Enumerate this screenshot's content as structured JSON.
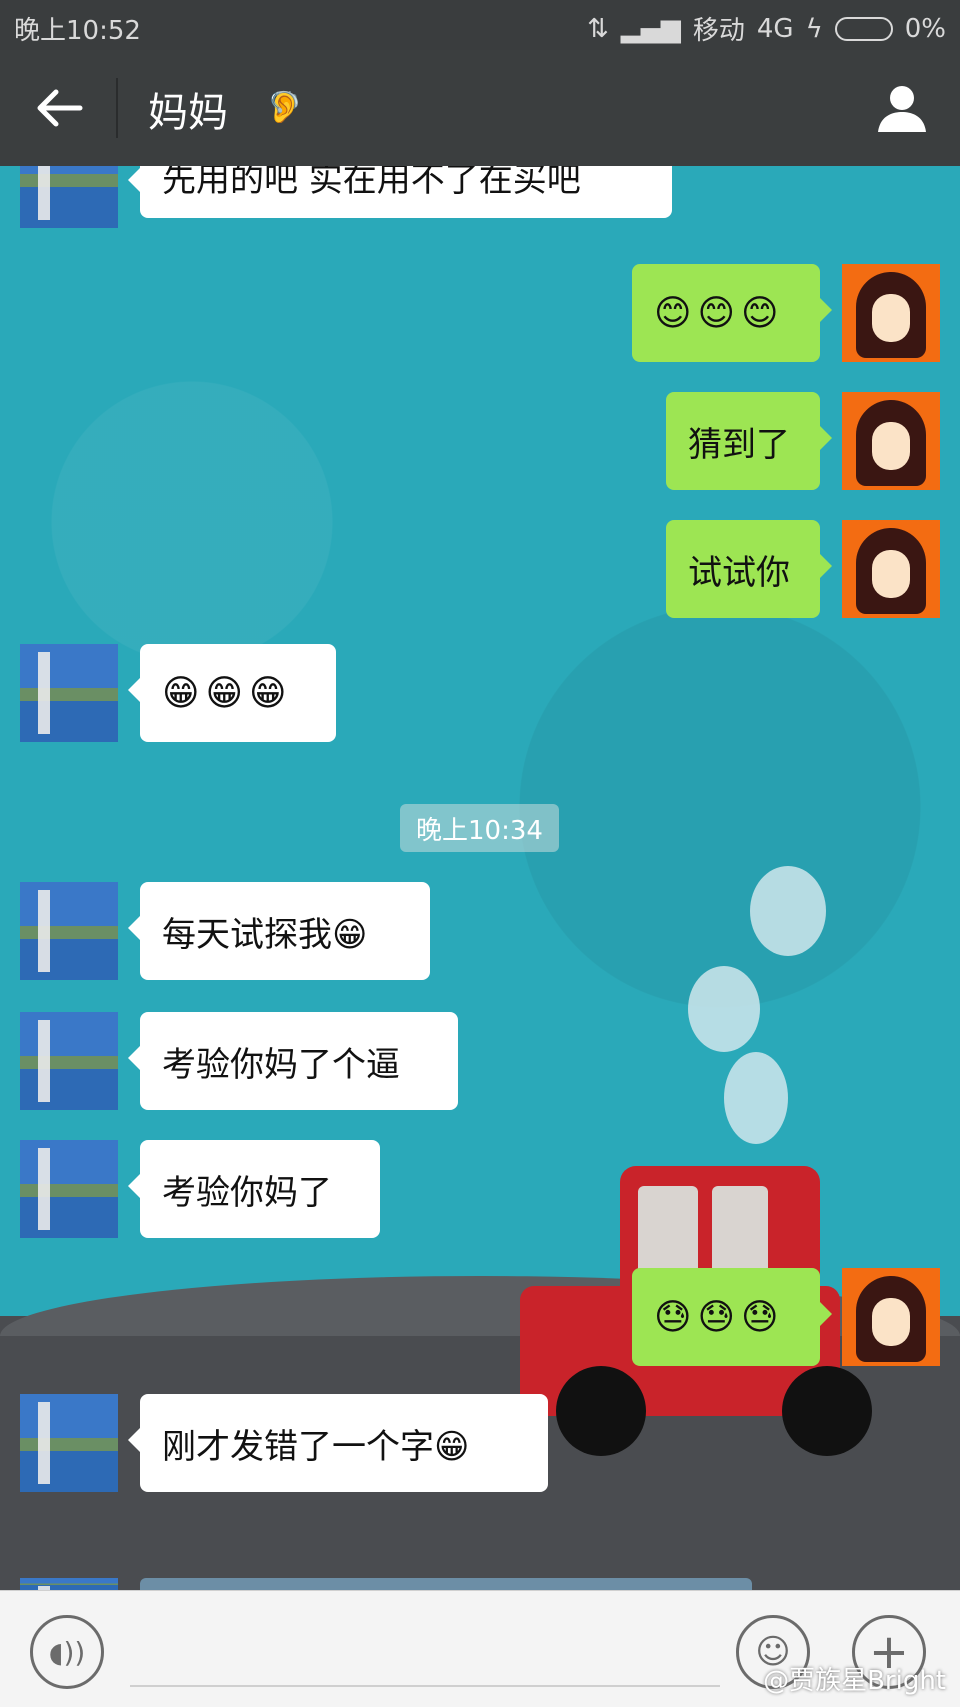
{
  "status_bar": {
    "time": "晚上10:52",
    "carrier": "移动",
    "network": "4G",
    "battery": "0%"
  },
  "header": {
    "title": "妈妈",
    "back_icon": "arrow-left",
    "ear_icon": "ear-icon",
    "contact_icon": "person-icon"
  },
  "messages": [
    {
      "side": "left",
      "text": "先用的吧 实在用不了在买吧"
    },
    {
      "side": "right",
      "text": "😊😊😊"
    },
    {
      "side": "right",
      "text": "猜到了"
    },
    {
      "side": "right",
      "text": "试试你"
    },
    {
      "side": "left",
      "text": "😁😁😁"
    },
    {
      "side": "timestamp",
      "text": "晚上10:34"
    },
    {
      "side": "left",
      "text": "每天试探我😁"
    },
    {
      "side": "left",
      "text": "考验你妈了个逼"
    },
    {
      "side": "left",
      "text": "考验你妈了"
    },
    {
      "side": "right",
      "text": "😓😓😓"
    },
    {
      "side": "left",
      "text": "刚才发错了一个字😁"
    }
  ],
  "input_bar": {
    "voice_icon": "voice-icon",
    "emoji_icon": "emoji-icon",
    "plus_icon": "plus-icon"
  },
  "watermark": "@贾族星Bright"
}
